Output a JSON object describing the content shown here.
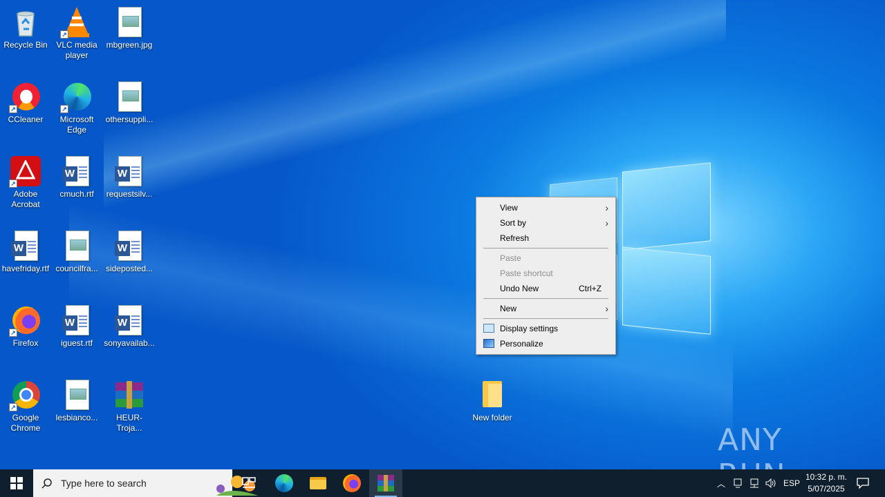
{
  "desktop": {
    "icons": [
      {
        "label": "Recycle Bin",
        "icon": "recycle-bin-icon"
      },
      {
        "label": "VLC media player",
        "icon": "vlc-icon"
      },
      {
        "label": "mbgreen.jpg",
        "icon": "image-file-icon"
      },
      {
        "label": "CCleaner",
        "icon": "ccleaner-icon"
      },
      {
        "label": "Microsoft Edge",
        "icon": "edge-icon"
      },
      {
        "label": "othersuppli...",
        "icon": "image-file-icon"
      },
      {
        "label": "Adobe Acrobat",
        "icon": "acrobat-icon"
      },
      {
        "label": "cmuch.rtf",
        "icon": "word-doc-icon"
      },
      {
        "label": "requestsilv...",
        "icon": "word-doc-icon"
      },
      {
        "label": "havefriday.rtf",
        "icon": "word-doc-icon"
      },
      {
        "label": "councilfra...",
        "icon": "image-file-icon"
      },
      {
        "label": "sideposted...",
        "icon": "word-doc-icon"
      },
      {
        "label": "Firefox",
        "icon": "firefox-icon"
      },
      {
        "label": "iguest.rtf",
        "icon": "word-doc-icon"
      },
      {
        "label": "sonyavailab...",
        "icon": "word-doc-icon"
      },
      {
        "label": "Google Chrome",
        "icon": "chrome-icon"
      },
      {
        "label": "lesbianco...",
        "icon": "image-file-icon"
      },
      {
        "label": "HEUR-Troja...",
        "icon": "winrar-icon"
      }
    ],
    "new_folder": {
      "label": "New folder",
      "icon": "folder-icon"
    }
  },
  "context_menu": {
    "items": [
      {
        "label": "View",
        "submenu": true
      },
      {
        "label": "Sort by",
        "submenu": true
      },
      {
        "label": "Refresh"
      },
      {
        "label": "Paste",
        "disabled": true
      },
      {
        "label": "Paste shortcut",
        "disabled": true
      },
      {
        "label": "Undo New",
        "shortcut": "Ctrl+Z"
      },
      {
        "label": "New",
        "submenu": true
      },
      {
        "label": "Display settings",
        "icon": "display-settings-icon"
      },
      {
        "label": "Personalize",
        "icon": "personalize-icon"
      }
    ]
  },
  "taskbar": {
    "search_placeholder": "Type here to search",
    "apps": [
      "task-view-icon",
      "edge-icon",
      "file-explorer-icon",
      "firefox-icon",
      "winrar-icon"
    ],
    "language": "ESP",
    "time": "10:32 p. m.",
    "date": "5/07/2025"
  },
  "watermark": "ANY RUN",
  "colors": {
    "menu_bg": "#eeeeee",
    "taskbar_bg": "#0f1f2e",
    "wallpaper_blue": "#0b79e0"
  }
}
